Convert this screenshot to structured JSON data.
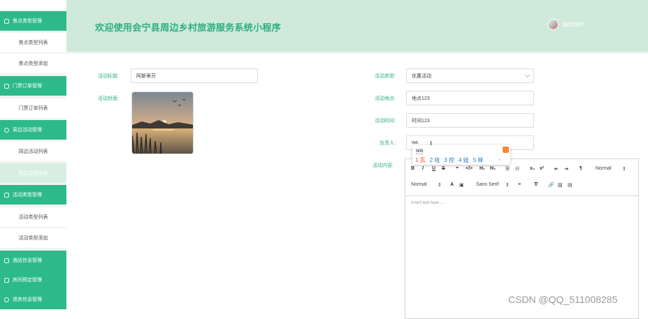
{
  "sidebar": {
    "items": [
      {
        "label": "",
        "type": "sub"
      },
      {
        "label": "景点类型管理",
        "type": "group"
      },
      {
        "label": "景点类型列表",
        "type": "sub"
      },
      {
        "label": "景点类型添加",
        "type": "sub"
      },
      {
        "label": "门票订单管理",
        "type": "group"
      },
      {
        "label": "门票订单列表",
        "type": "sub"
      },
      {
        "label": "周边活动管理",
        "type": "group"
      },
      {
        "label": "周边活动列表",
        "type": "sub"
      },
      {
        "label": "周边活动添加",
        "type": "sub",
        "active": true
      },
      {
        "label": "活动类型管理",
        "type": "group"
      },
      {
        "label": "活动类型列表",
        "type": "sub"
      },
      {
        "label": "活动类型添加",
        "type": "sub"
      },
      {
        "label": "酒店信息管理",
        "type": "group"
      },
      {
        "label": "房间预定管理",
        "type": "group"
      },
      {
        "label": "退房信息管理",
        "type": "group"
      }
    ]
  },
  "header": {
    "title": "欢迎使用会宁县周边乡村旅游服务系统小程序",
    "username": "admin"
  },
  "form": {
    "title_label": "活动标题:",
    "title_value": "阿斯蒂芬",
    "cover_label": "活动封面:",
    "type_label": "活动类型:",
    "type_value": "优惠活动",
    "location_label": "活动地点:",
    "location_value": "地点123",
    "time_label": "活动时间:",
    "time_value": "时间123",
    "person_label": "负责人:",
    "person_value": "wa",
    "content_label": "活动内容:"
  },
  "ime": {
    "composition": "wa",
    "candidates": [
      "1 瓦",
      "2 哇",
      "3 挖",
      "4 娃",
      "5 袜"
    ],
    "next": "›"
  },
  "editor": {
    "row1": [
      "B",
      "I",
      "U",
      "S",
      "❞",
      "</>",
      "H₁",
      "H₂",
      "☰",
      "☷",
      "x₂",
      "x²",
      "⇤",
      "⇥",
      "¶",
      "Normal",
      "⇕"
    ],
    "row2": [
      "Normal",
      "⇕",
      "A",
      "▣",
      "Sans Serif",
      "⇕",
      "≡",
      "T̸",
      "🔗",
      "▨",
      "▤"
    ],
    "placeholder": "Insert text here ..."
  },
  "watermark": "CSDN @QQ_511008285",
  "colors": {
    "accent": "#2dba8b",
    "header_bg": "#cfeadb",
    "label": "#2dae83"
  },
  "icons": [
    "clipboard-icon",
    "edit-icon",
    "shield-icon",
    "user-avatar"
  ]
}
